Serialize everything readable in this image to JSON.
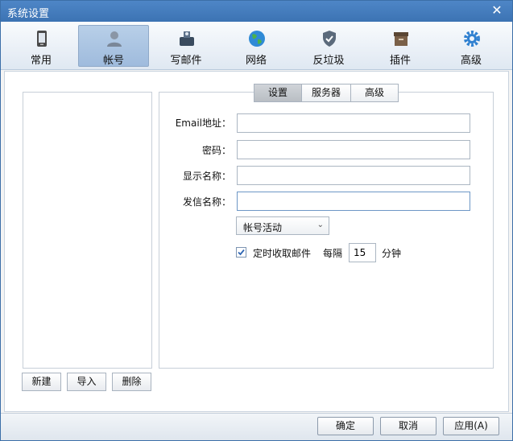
{
  "window": {
    "title": "系统设置"
  },
  "toolbar": {
    "items": [
      {
        "label": "常用",
        "icon": "phone-icon"
      },
      {
        "label": "帐号",
        "icon": "user-icon",
        "active": true
      },
      {
        "label": "写邮件",
        "icon": "compose-mail-icon"
      },
      {
        "label": "网络",
        "icon": "globe-icon"
      },
      {
        "label": "反垃圾",
        "icon": "shield-icon"
      },
      {
        "label": "插件",
        "icon": "plugin-box-icon"
      },
      {
        "label": "高级",
        "icon": "gear-icon"
      }
    ]
  },
  "accounts": {
    "buttons": {
      "new": "新建",
      "import": "导入",
      "delete": "删除"
    }
  },
  "tabs": [
    {
      "label": "设置",
      "active": true
    },
    {
      "label": "服务器"
    },
    {
      "label": "高级"
    }
  ],
  "form": {
    "email_label": "Email地址：",
    "email_value": "",
    "password_label": "密码：",
    "password_value": "",
    "display_name_label": "显示名称：",
    "display_name_value": "",
    "sender_name_label": "发信名称：",
    "sender_name_value": "",
    "account_state": "帐号活动",
    "auto_fetch_label": "定时收取邮件",
    "auto_fetch_checked": true,
    "interval_label": "每隔",
    "interval_value": "15",
    "interval_unit": "分钟"
  },
  "footer": {
    "ok": "确定",
    "cancel": "取消",
    "apply": "应用(A)"
  },
  "colors": {
    "title_bar": "#3c73b3",
    "active_tool": "#9fbbdd",
    "checkbox_accent": "#2f66b3"
  }
}
